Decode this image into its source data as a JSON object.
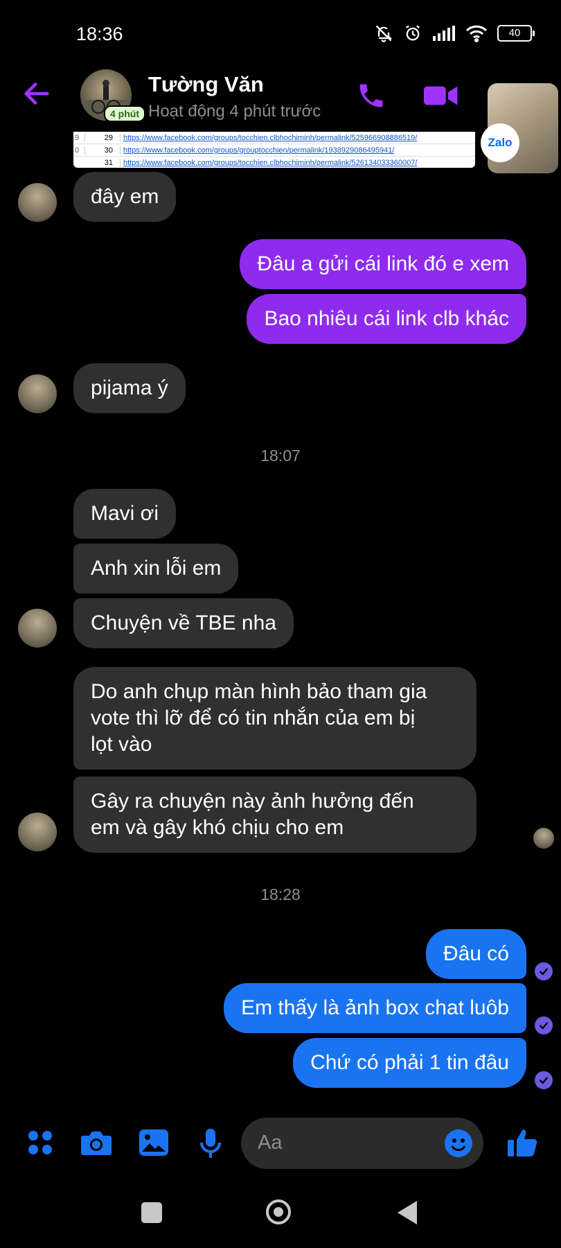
{
  "status_bar": {
    "time": "18:36",
    "battery": "40"
  },
  "header": {
    "name": "Tường Văn",
    "active_badge": "4 phút",
    "active_status": "Hoạt động 4 phút trước"
  },
  "shared_preview": {
    "rows": [
      {
        "row": "9",
        "num": "29",
        "url": "https://www.facebook.com/groups/tocchien.clbhochiminh/permalink/525966908886519/"
      },
      {
        "row": "0",
        "num": "30",
        "url": "https://www.facebook.com/groups/grouptocchien/permalink/1938929086495941/"
      },
      {
        "row": "",
        "num": "31",
        "url": "https://www.facebook.com/groups/tocchien.clbhochiminh/permalink/526134033360007/"
      }
    ]
  },
  "zalo": {
    "label": "Zalo"
  },
  "messages": [
    {
      "id": "m1",
      "text": "đây em"
    },
    {
      "id": "m2",
      "text": "Đâu a gửi cái link đó e xem"
    },
    {
      "id": "m3",
      "text": "Bao nhiêu cái link clb khác"
    },
    {
      "id": "m4",
      "text": "pijama ý"
    },
    {
      "id": "m5",
      "text": "Mavi ơi"
    },
    {
      "id": "m6",
      "text": "Anh xin lỗi em"
    },
    {
      "id": "m7",
      "text": "Chuyện về TBE nha"
    },
    {
      "id": "m8",
      "lines": [
        "Do anh chụp màn hình bảo tham gia",
        "vote thì lỡ để có tin nhắn của em bị",
        "lọt vào"
      ]
    },
    {
      "id": "m9",
      "lines": [
        "Gây ra chuyện này ảnh hưởng đến",
        "em và gây khó chịu cho em"
      ]
    },
    {
      "id": "m10",
      "text": "Đâu có"
    },
    {
      "id": "m11",
      "text": "Em thấy là ảnh box chat luôb"
    },
    {
      "id": "m12",
      "text": "Chứ có phải 1 tin đâu"
    }
  ],
  "timestamps": {
    "t1": "18:07",
    "t2": "18:28"
  },
  "composer": {
    "placeholder": "Aa"
  },
  "colors": {
    "purple": "#8f2bee",
    "blue": "#1a74f2",
    "incoming": "#303030",
    "accent": "#a033ff"
  }
}
